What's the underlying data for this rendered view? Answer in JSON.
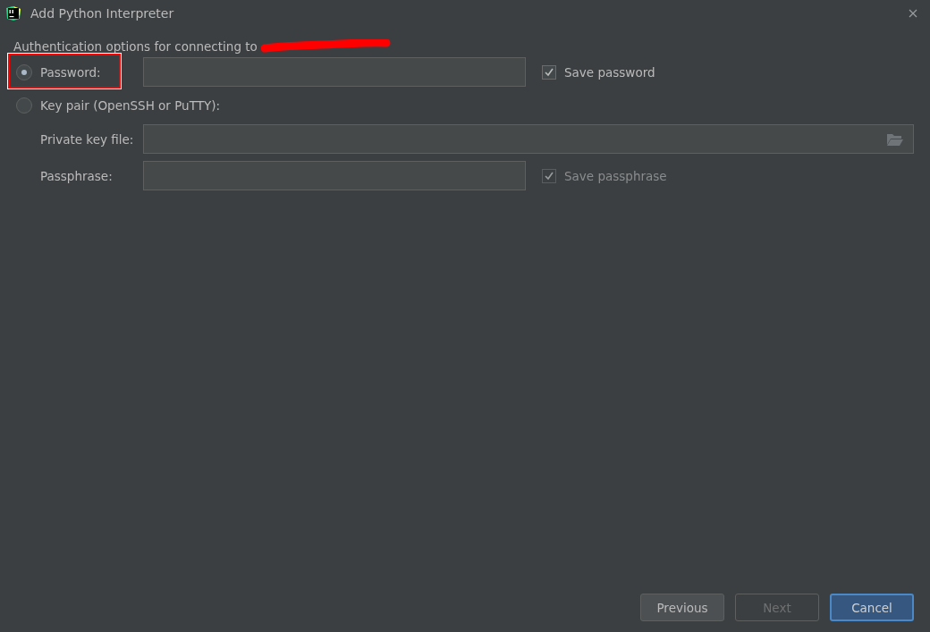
{
  "window": {
    "title": "Add Python Interpreter"
  },
  "auth_label": "Authentication options for connecting to",
  "password_option": {
    "label": "Password:",
    "selected": true,
    "save": {
      "label": "Save password",
      "checked": true,
      "disabled": false
    }
  },
  "keypair_option": {
    "label": "Key pair (OpenSSH or PuTTY):",
    "selected": false
  },
  "key_fields": [
    {
      "kind": "file",
      "label": "Private key file:"
    },
    {
      "kind": "text",
      "label": "Passphrase:",
      "save": {
        "label": "Save passphrase",
        "checked": true,
        "disabled": true
      }
    }
  ],
  "buttons": [
    {
      "label": "Previous",
      "disabled": false,
      "default": false
    },
    {
      "label": "Next",
      "disabled": true,
      "default": false
    },
    {
      "label": "Cancel",
      "disabled": false,
      "default": true
    }
  ]
}
